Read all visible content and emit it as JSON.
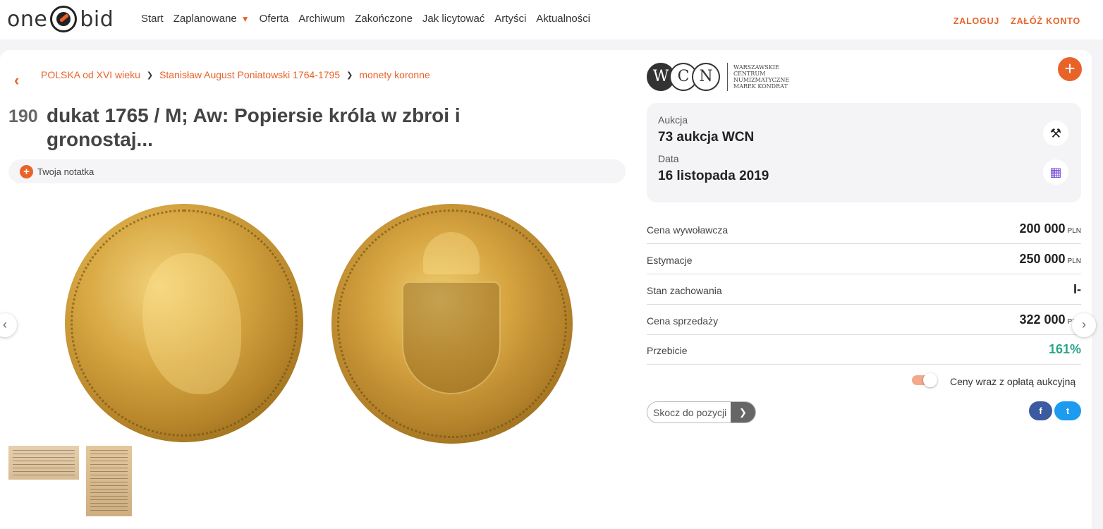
{
  "header": {
    "logo_left": "one",
    "logo_right": "bid",
    "nav": [
      {
        "label": "Start"
      },
      {
        "label": "Zaplanowane",
        "has_dropdown": true
      },
      {
        "label": "Oferta"
      },
      {
        "label": "Archiwum"
      },
      {
        "label": "Zakończone"
      },
      {
        "label": "Jak licytować"
      },
      {
        "label": "Artyści"
      },
      {
        "label": "Aktualności"
      }
    ],
    "login": "ZALOGUJ",
    "register": "ZAŁÓŻ KONTO"
  },
  "breadcrumb": {
    "items": [
      "POLSKA od XVI wieku",
      "Stanisław August Poniatowski 1764-1795",
      "monety koronne"
    ]
  },
  "lot": {
    "number": "190",
    "title": "dukat 1765 / M; Aw: Popiersie króla w zbroi i gronostaj..."
  },
  "note": {
    "label": "Twoja notatka"
  },
  "auction_house": {
    "letters": [
      "W",
      "C",
      "N"
    ],
    "text_lines": [
      "WARSZAWSKIE",
      "CENTRUM",
      "NUMIZMATYCZNE",
      "MAREK KONDRAT"
    ]
  },
  "auction": {
    "auction_label": "Aukcja",
    "auction_value": "73 aukcja WCN",
    "date_label": "Data",
    "date_value": "16 listopada 2019"
  },
  "details": [
    {
      "label": "Cena wywoławcza",
      "value": "200 000",
      "currency": "PLN"
    },
    {
      "label": "Estymacje",
      "value": "250 000",
      "currency": "PLN"
    },
    {
      "label": "Stan zachowania",
      "value": "I-",
      "currency": ""
    },
    {
      "label": "Cena sprzedaży",
      "value": "322 000",
      "currency": "PLN"
    },
    {
      "label": "Przebicie",
      "value": "161%",
      "currency": ""
    }
  ],
  "toggle": {
    "label": "Ceny wraz z opłatą aukcyjną",
    "on": true
  },
  "jump": {
    "placeholder": "Skocz do pozycji"
  },
  "social": {
    "facebook": "f",
    "twitter": "t"
  },
  "colors": {
    "accent": "#e8632a",
    "positive": "#2aa68a",
    "facebook": "#3b5aa0",
    "twitter": "#1d9bf0"
  }
}
